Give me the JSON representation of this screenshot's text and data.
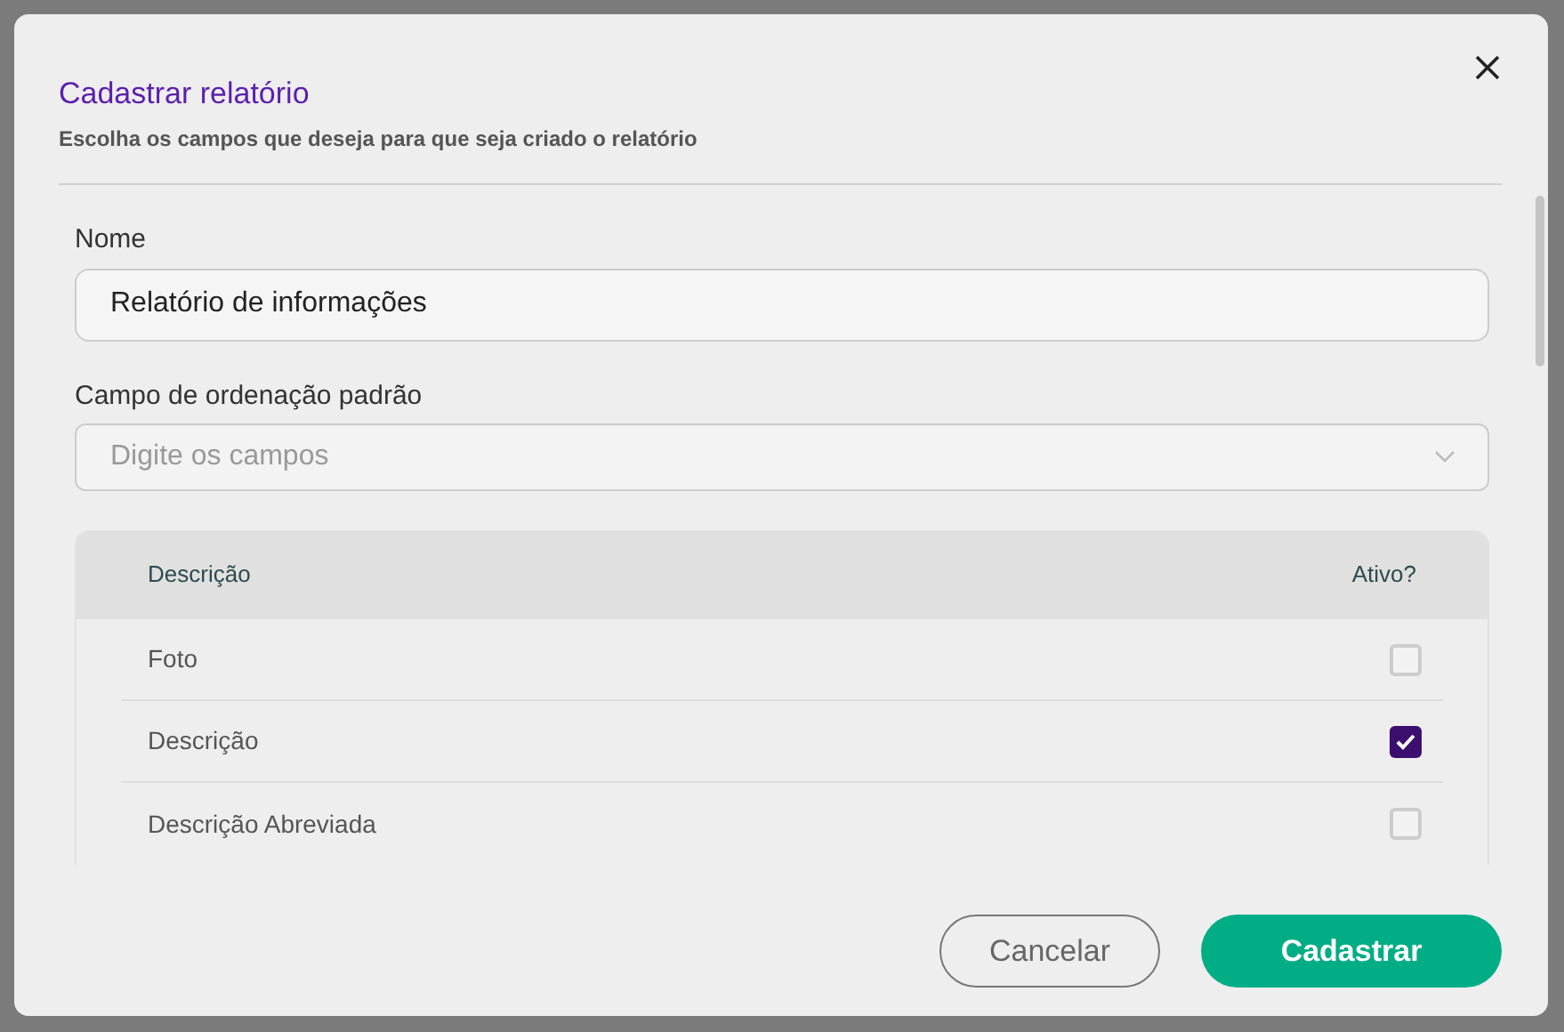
{
  "dialog": {
    "title": "Cadastrar relatório",
    "subtitle": "Escolha os campos que deseja para que seja criado o relatório"
  },
  "name_field": {
    "label": "Nome",
    "value": "Relatório de informações"
  },
  "sort_field": {
    "label": "Campo de ordenação padrão",
    "placeholder": "Digite os campos"
  },
  "table": {
    "columns": [
      "Descrição",
      "Ativo?"
    ],
    "rows": [
      {
        "description": "Foto",
        "checked": false
      },
      {
        "description": "Descrição",
        "checked": true
      },
      {
        "description": "Descrição Abreviada",
        "checked": false
      }
    ]
  },
  "buttons": {
    "cancel": "Cancelar",
    "submit": "Cadastrar"
  }
}
